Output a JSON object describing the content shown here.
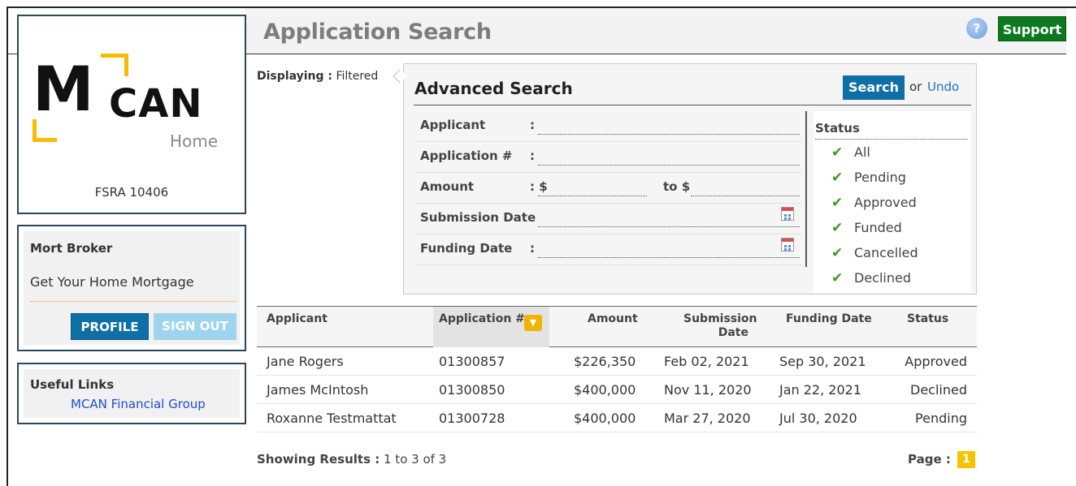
{
  "header": {
    "title": "Application Search",
    "help_icon": "?",
    "support_label": "Support",
    "support_color": "#0b7a1f"
  },
  "sidebar": {
    "logo": {
      "mark": "M",
      "word": "CAN",
      "sub": "Home",
      "accent_color": "#f5bc00"
    },
    "license": "FSRA 10406",
    "broker": {
      "name": "Mort Broker",
      "tagline": "Get Your Home Mortgage",
      "profile_label": "PROFILE",
      "signout_label": "SIGN OUT"
    },
    "links": {
      "title": "Useful Links",
      "items": [
        "MCAN Financial Group"
      ]
    }
  },
  "main": {
    "displaying_label": "Displaying :",
    "displaying_value": "Filtered",
    "advanced_search": {
      "title": "Advanced Search",
      "search_label": "Search",
      "or_text": "or",
      "undo_label": "Undo",
      "fields": {
        "applicant": "Applicant",
        "application_no": "Application #",
        "amount": "Amount",
        "submission_date": "Submission Date",
        "funding_date": "Funding Date",
        "colon": ":",
        "dollar_from": ": $",
        "dollar_to": "to $"
      },
      "status": {
        "title": "Status",
        "items": [
          "All",
          "Pending",
          "Approved",
          "Funded",
          "Cancelled",
          "Declined"
        ]
      }
    },
    "table": {
      "headers": [
        "Applicant",
        "Application #",
        "Amount",
        "Submission Date",
        "Funding Date",
        "Status"
      ],
      "header_sub": {
        "submission": "Submission",
        "date": "Date"
      },
      "sort_icon": "chevron-down-icon",
      "rows": [
        [
          "Jane Rogers",
          "01300857",
          "$226,350",
          "Feb 02, 2021",
          "Sep 30, 2021",
          "Approved"
        ],
        [
          "James McIntosh",
          "01300850",
          "$400,000",
          "Nov 11, 2020",
          "Jan 22, 2021",
          "Declined"
        ],
        [
          "Roxanne Testmattat",
          "01300728",
          "$400,000",
          "Mar 27, 2020",
          "Jul 30, 2020",
          "Pending"
        ]
      ]
    },
    "footer": {
      "showing_label": "Showing Results :",
      "showing_value": "1 to 3 of 3",
      "page_label": "Page :",
      "page_current": "1"
    }
  },
  "colors": {
    "primary_button": "#0d6fa6",
    "panel_border": "#2d4659",
    "link": "#1a4fd0",
    "check": "#3c9a1e",
    "page_highlight": "#f5c400"
  }
}
